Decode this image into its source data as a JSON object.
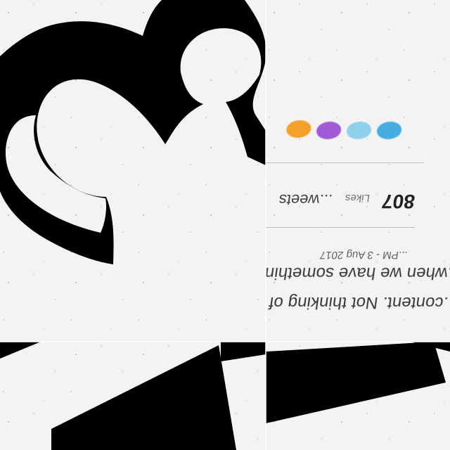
{
  "tweet": {
    "line_one": "...content. Not thinking of it as content.",
    "line_two": "...when we have something to share.",
    "line_three": "...",
    "timestamp": "...PM - 3 Aug 2017",
    "likes_count": "807",
    "likes_label": "Likes",
    "retweets_label": "...weets"
  },
  "colors": {
    "black_glyph": "#000000",
    "background": "#efefef",
    "avatar_blue": "#37a8df",
    "avatar_light_blue": "#88cdea",
    "avatar_purple": "#9a4ed2",
    "avatar_orange": "#f39b19"
  },
  "icons": {
    "large_glyph": "large-number-three-glyph",
    "lower_stroke": "black-diagonal-stroke"
  }
}
